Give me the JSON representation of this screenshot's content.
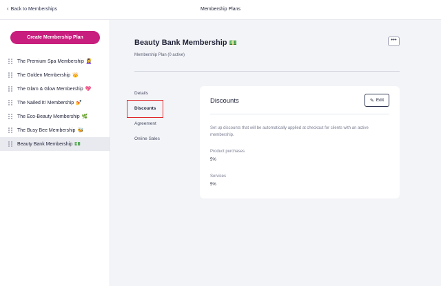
{
  "header": {
    "back_label": "Back to Memberships",
    "title": "Membership Plans"
  },
  "sidebar": {
    "create_label": "Create Membership Plan",
    "items": [
      {
        "label": "The Premium Spa Membership",
        "emoji": "💆‍♀️"
      },
      {
        "label": "The Golden Membership",
        "emoji": "👑"
      },
      {
        "label": "The Glam & Glow Membership",
        "emoji": "💖"
      },
      {
        "label": "The Nailed It! Membership",
        "emoji": "💅"
      },
      {
        "label": "The Eco-Beauty Membership",
        "emoji": "🌿"
      },
      {
        "label": "The Busy Bee Membership",
        "emoji": "🐝"
      },
      {
        "label": "Beauty Bank Membership",
        "emoji": "💵"
      }
    ],
    "active_index": 6
  },
  "main": {
    "title": "Beauty Bank Membership",
    "title_emoji": "💵",
    "more_label": "•••",
    "subtitle": "Membership Plan (0 active)",
    "tabs": [
      "Details",
      "Discounts",
      "Agreement",
      "Online Sales"
    ],
    "active_tab": 1
  },
  "card": {
    "title": "Discounts",
    "edit_label": "Edit",
    "description": "Set up discounts that will be automatically applied at checkout for clients with an active membership.",
    "fields": [
      {
        "label": "Product purchases",
        "value": "5%"
      },
      {
        "label": "Services",
        "value": "5%"
      }
    ]
  },
  "colors": {
    "accent": "#c81e7d",
    "highlight": "#e0262b"
  }
}
